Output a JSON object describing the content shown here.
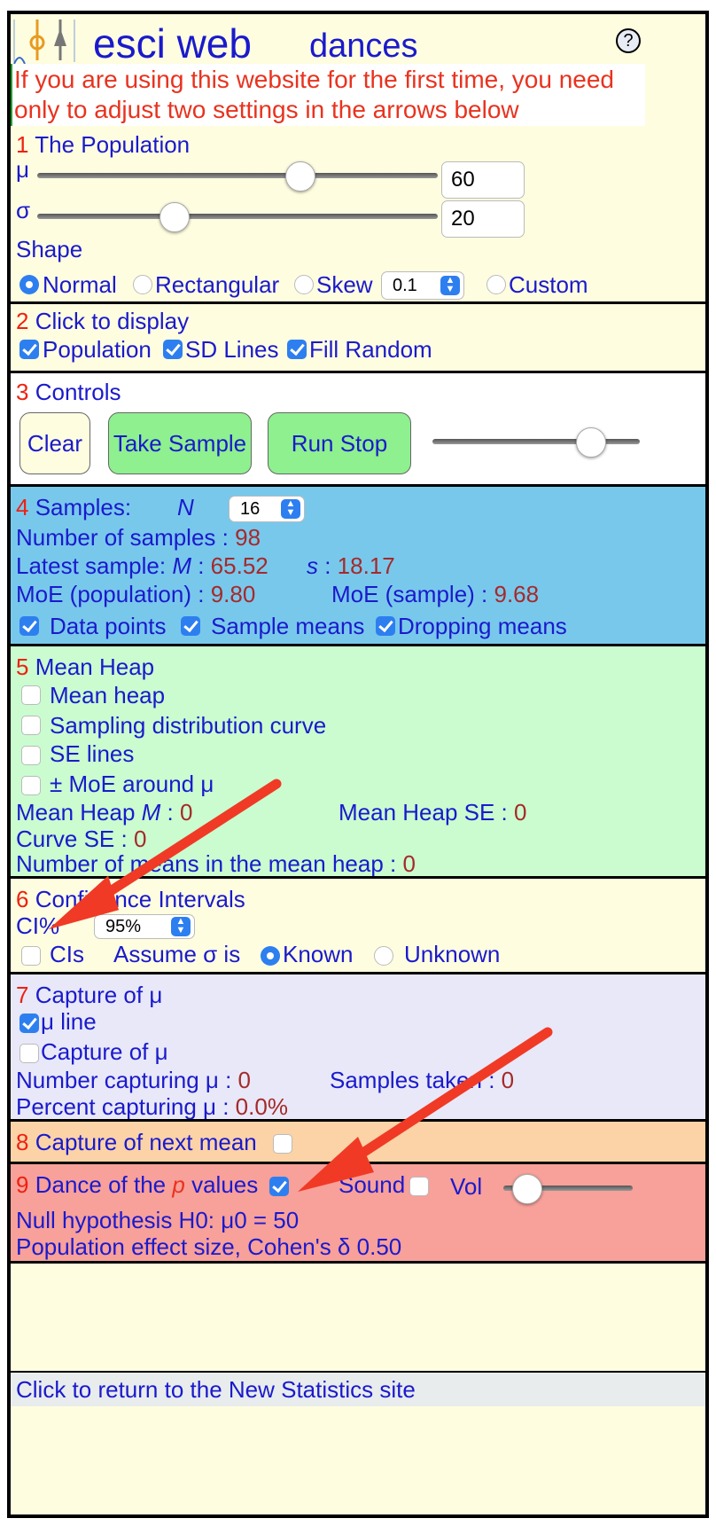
{
  "header": {
    "title": "esci web",
    "subtitle": "dances",
    "help_label": "?",
    "intro": [
      "If  you are using this website for the first time, you need",
      "only to adjust two settings in the arrows below"
    ]
  },
  "population": {
    "number": "1",
    "heading": "The Population",
    "mu_label": "μ",
    "mu_value": "60",
    "sigma_label": "σ",
    "sigma_value": "20",
    "shape_label": "Shape",
    "shapes": [
      "Normal",
      "Rectangular",
      "Skew",
      "Custom"
    ],
    "selected_shape": "Normal",
    "skew_value": "0.1"
  },
  "display": {
    "number": "2",
    "heading": "Click to display",
    "options": [
      "Population",
      "SD Lines",
      "Fill Random"
    ]
  },
  "controls": {
    "number": "3",
    "heading": "Controls",
    "clear": "Clear",
    "take_sample": "Take Sample",
    "run_stop": "Run Stop"
  },
  "samples": {
    "number": "4",
    "heading": "Samples:",
    "n_label": "N",
    "n_value": "16",
    "num_samples_label": "Number of samples :",
    "num_samples": "98",
    "latest_label": "Latest sample:",
    "m_label": "M",
    "m_value": "65.52",
    "s_label": "s",
    "s_value": "18.17",
    "moe_pop_label": "MoE (population) :",
    "moe_pop": "9.80",
    "moe_sample_label": "MoE (sample) :",
    "moe_sample": "9.68",
    "options": [
      "Data points",
      "Sample means",
      "Dropping means"
    ]
  },
  "mean_heap": {
    "number": "5",
    "heading": "Mean Heap",
    "options": [
      "Mean heap",
      "Sampling distribution curve",
      "SE lines",
      "± MoE around μ"
    ],
    "heap_m_label": "Mean Heap",
    "heap_m_value": "0",
    "heap_se_label": "Mean Heap SE :",
    "heap_se_value": "0",
    "curve_se_label": "Curve SE :",
    "curve_se_value": "0",
    "count_label": "Number of means in the mean heap :",
    "count_value": "0"
  },
  "ci": {
    "number": "6",
    "heading": "Confidence Intervals",
    "ci_label": "CI%",
    "ci_value": "95%",
    "cis_label": "CIs",
    "assume_label": "Assume σ is",
    "known": "Known",
    "unknown": "Unknown"
  },
  "capture": {
    "number": "7",
    "heading": "Capture of μ",
    "mu_line": "μ line",
    "capture_label": "Capture of μ",
    "num_capturing_label": "Number capturing μ :",
    "num_capturing": "0",
    "samples_taken_label": "Samples taken :",
    "samples_taken": "0",
    "percent_label": "Percent capturing μ :",
    "percent": "0.0%"
  },
  "next_mean": {
    "number": "8",
    "heading": "Capture of next mean"
  },
  "pvalues": {
    "number": "9",
    "heading_pre": "Dance of the",
    "heading_p": "p",
    "heading_post": "values",
    "sound": "Sound",
    "vol": "Vol",
    "null_hyp": "Null hypothesis H0: μ0 = 50",
    "effect_size": "Population effect size, Cohen's δ 0.50"
  },
  "footer": {
    "link": "Click to return to the New Statistics site"
  },
  "colors": {
    "panel_yellow": "#fefde0",
    "panel_blue": "#78c8ec",
    "panel_green": "#cafccf",
    "panel_lavender": "#e8e8f8",
    "panel_orange": "#fbd3a7",
    "panel_red": "#f8a09a",
    "button_green": "#8ef08e",
    "arrow_red": "#f03a25"
  }
}
